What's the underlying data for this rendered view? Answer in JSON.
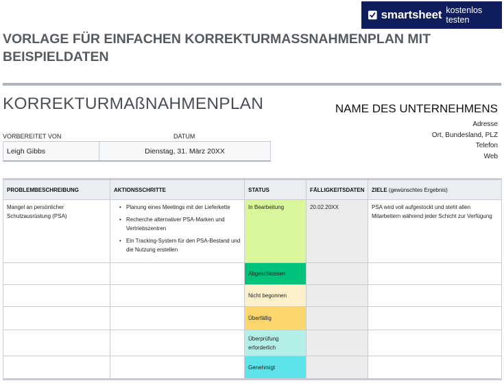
{
  "banner": {
    "brand": "smartsheet",
    "cta": "kostenlos testen",
    "icon": "smartsheet-check-icon",
    "background": "#0f1d5c"
  },
  "document_title": "VORLAGE FÜR EINFACHEN KORREKTURMASSNAHMENPLAN MIT BEISPIELDATEN",
  "plan_title": "KORREKTURMAßNAHMENPLAN",
  "company": {
    "name": "NAME DES UNTERNEHMENS",
    "address": "Adresse",
    "city": "Ort, Bundesland, PLZ",
    "phone": "Telefon",
    "web": "Web"
  },
  "prepared": {
    "by_label": "VORBEREITET VON",
    "date_label": "DATUM",
    "by_value": "Leigh Gibbs",
    "date_value": "Dienstag, 31. März 20XX"
  },
  "table": {
    "headers": {
      "problem": "PROBLEMBESCHREIBUNG",
      "actions": "AKTIONSSCHRITTE",
      "status": "STATUS",
      "due": "FÄLLIGKEITSDATEN",
      "goals": "ZIELE",
      "goals_sub": "(gewünschtes Ergebnis)"
    },
    "rows": [
      {
        "problem": "Mangel an persönlicher Schutzausrüstung (PSA)",
        "actions": [
          "Planung eines Meetings mit der Lieferkette",
          "Recherche alternativer PSA-Marken und Vertriebszentren",
          "Ein Tracking-System für den PSA-Bestand und die Nutzung erstellen"
        ],
        "status": "In Bearbeitung",
        "status_color": "#d9f79b",
        "due": "20.02.20XX",
        "goals": "PSA wird voll aufgestockt und steht allen Mitarbeitern während jeder Schicht zur Verfügung"
      },
      {
        "problem": "",
        "status": "Abgeschlossen",
        "status_color": "#00c27a",
        "due": "",
        "goals": ""
      },
      {
        "problem": "",
        "status": "Nicht begonnen",
        "status_color": "#fdf1cc",
        "due": "",
        "goals": ""
      },
      {
        "problem": "",
        "status": "Überfällig",
        "status_color": "#fdd66d",
        "due": "",
        "goals": ""
      },
      {
        "problem": "",
        "status": "Überprüfung erforderlich",
        "status_color": "#b3efe6",
        "due": "",
        "goals": ""
      },
      {
        "problem": "",
        "status": "Genehmigt",
        "status_color": "#5ee3e8",
        "due": "",
        "goals": ""
      }
    ]
  }
}
